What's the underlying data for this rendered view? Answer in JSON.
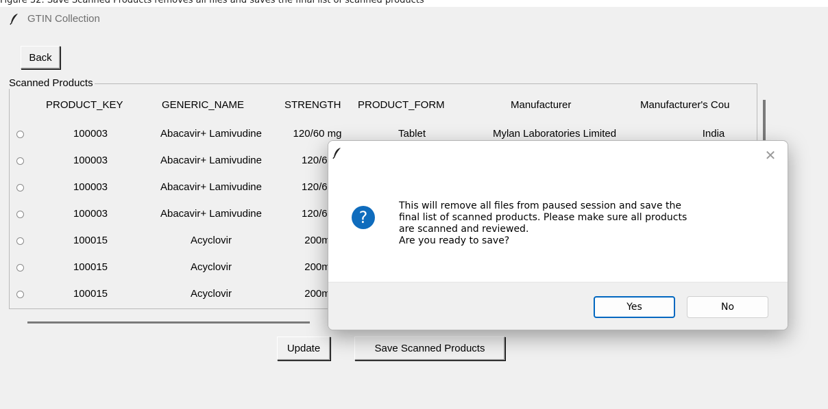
{
  "caption": "Figure 32: Save Scanned Products removes all files and saves the final list of scanned products",
  "window": {
    "title": "GTIN Collection"
  },
  "back_button": "Back",
  "frame_label": "Scanned Products",
  "table": {
    "headers": [
      "PRODUCT_KEY",
      "GENERIC_NAME",
      "STRENGTH",
      "PRODUCT_FORM",
      "Manufacturer",
      "Manufacturer's Cou"
    ],
    "rows": [
      [
        "100003",
        "Abacavir+ Lamivudine",
        "120/60 mg",
        "Tablet",
        "Mylan Laboratories Limited",
        "India"
      ],
      [
        "100003",
        "Abacavir+ Lamivudine",
        "120/60",
        "",
        "",
        ""
      ],
      [
        "100003",
        "Abacavir+ Lamivudine",
        "120/60",
        "",
        "",
        ""
      ],
      [
        "100003",
        "Abacavir+ Lamivudine",
        "120/60",
        "",
        "",
        ""
      ],
      [
        "100015",
        "Acyclovir",
        "200m",
        "",
        "",
        ""
      ],
      [
        "100015",
        "Acyclovir",
        "200m",
        "",
        "",
        ""
      ],
      [
        "100015",
        "Acyclovir",
        "200m",
        "",
        "",
        ""
      ]
    ]
  },
  "buttons": {
    "update": "Update",
    "save": "Save Scanned Products"
  },
  "dialog": {
    "message": "This will remove all files from paused session and save the\nfinal list of scanned products. Please make sure all products\nare scanned and reviewed.\n Are you ready to save?",
    "yes": "Yes",
    "no": "No",
    "close_glyph": "✕",
    "icon_glyph": "?",
    "accent": "#0f6cbd"
  }
}
